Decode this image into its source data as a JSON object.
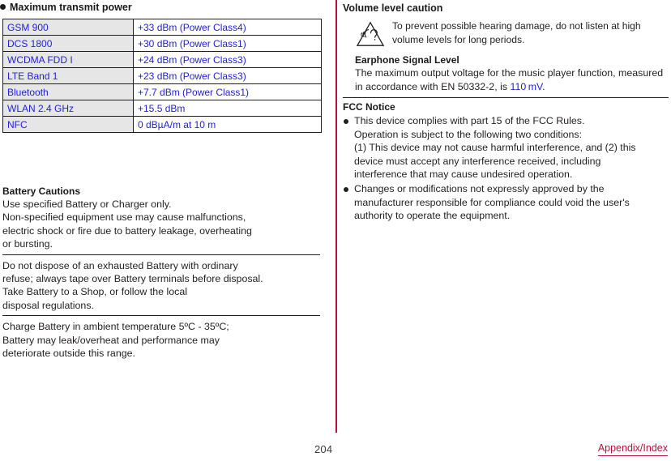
{
  "left_column": {
    "heading": "Maximum transmit power",
    "table": {
      "rows": [
        {
          "band": "GSM 900",
          "power": "+33 dBm (Power Class4)"
        },
        {
          "band": "DCS 1800",
          "power": "+30 dBm (Power Class1)"
        },
        {
          "band": "WCDMA FDD I",
          "power": "+24 dBm (Power Class3)"
        },
        {
          "band": "LTE Band 1",
          "power": "+23 dBm (Power Class3)"
        },
        {
          "band": "Bluetooth",
          "power": "+7.7 dBm (Power Class1)"
        },
        {
          "band": "WLAN 2.4 GHz",
          "power": "+15.5 dBm"
        },
        {
          "band": "NFC",
          "power": "0 dBµA/m at 10 m"
        }
      ]
    },
    "battery_cautions": {
      "heading": "Battery Cautions",
      "paragraphs": [
        " Use specified Battery or Charger only.\nNon-specified equipment use may cause malfunctions,\nelectric shock or fire due to battery leakage, overheating\nor bursting.",
        "Do not dispose of an exhausted Battery with ordinary\nrefuse; always tape over Battery terminals before disposal.\nTake Battery to a Shop, or follow the local\ndisposal regulations.",
        "Charge Battery in ambient temperature 5ºC - 35ºC;\nBattery may leak/overheat and performance may\ndeteriorate outside this range."
      ]
    }
  },
  "right_column": {
    "volume_caution": {
      "heading": "Volume level caution",
      "icon": "ear-warning-triangle-icon",
      "warning_text": "To prevent possible hearing damage, do not listen at high volume levels for long periods.",
      "earphone_heading": "Earphone Signal Level",
      "earphone_text_before": "The maximum output voltage for the music player function, measured in accordance with EN 50332-2, is ",
      "earphone_value": "110 mV",
      "earphone_text_after": "."
    },
    "fcc_notice": {
      "heading": "FCC Notice",
      "items": [
        "This device complies with part 15 of the FCC Rules.\nOperation is subject to the following two conditions:\n(1) This device may not cause harmful interference, and (2) this\ndevice must accept any interference received, including\ninterference that may cause undesired operation.",
        "Changes or modifications not expressly approved by the\nmanufacturer responsible for compliance could void the user's\nauthority to operate the equipment."
      ]
    }
  },
  "footer": {
    "page_number": "204",
    "section_label": "Appendix/Index"
  },
  "colors": {
    "accent_red": "#b4123c",
    "link_blue": "#2222dd",
    "body_text": "#231f20",
    "table_key_bg": "#e6e6e6"
  }
}
